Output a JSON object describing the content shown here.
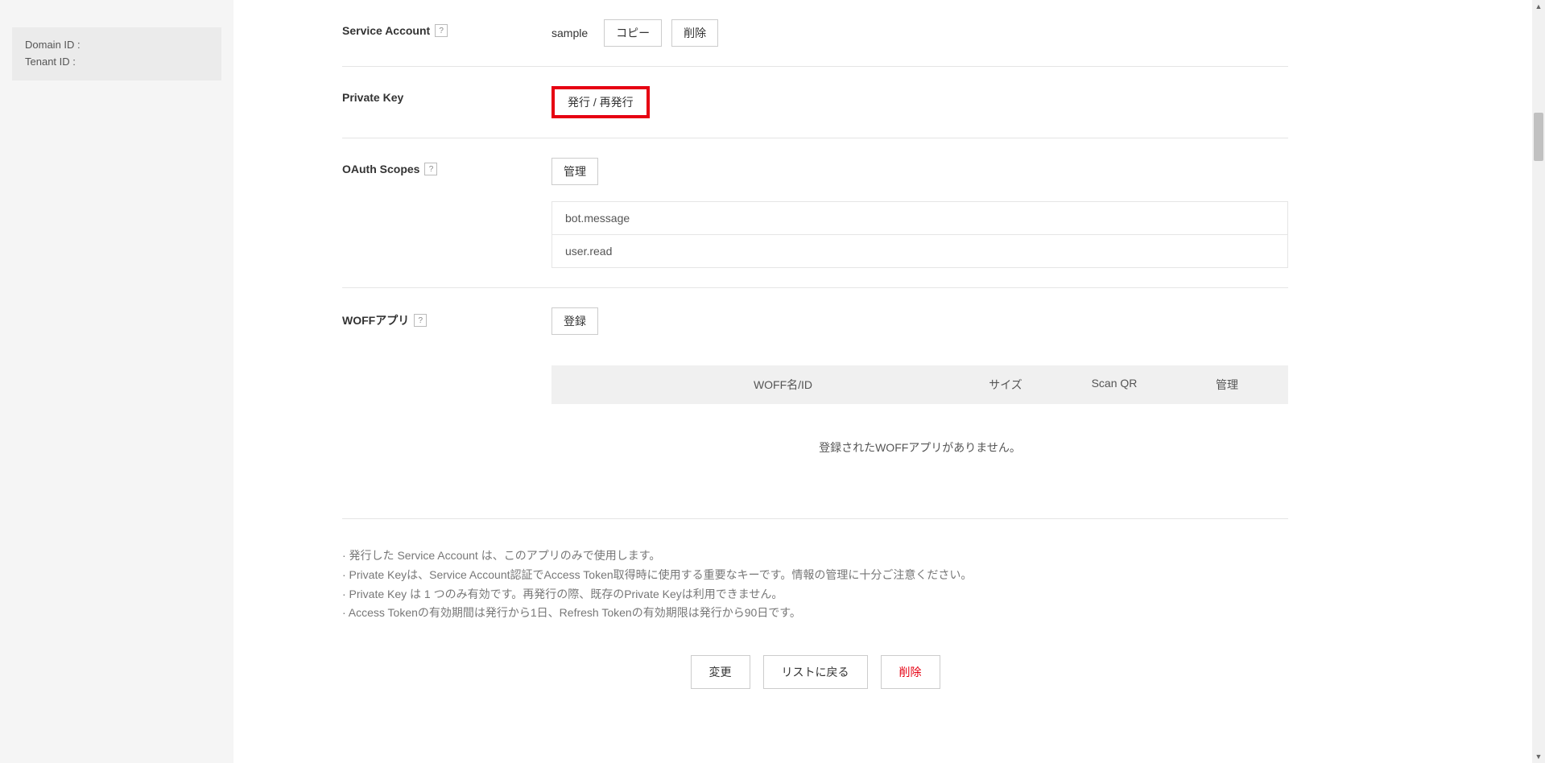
{
  "sidebar": {
    "domain_id_label": "Domain ID :",
    "tenant_id_label": "Tenant ID :"
  },
  "sections": {
    "service_account": {
      "label": "Service Account",
      "value": "sample",
      "copy_btn": "コピー",
      "delete_btn": "削除"
    },
    "private_key": {
      "label": "Private Key",
      "issue_btn": "発行 / 再発行"
    },
    "oauth_scopes": {
      "label": "OAuth Scopes",
      "manage_btn": "管理",
      "items": [
        "bot.message",
        "user.read"
      ]
    },
    "woff_app": {
      "label": "WOFFアプリ",
      "register_btn": "登録",
      "columns": {
        "name": "WOFF名/ID",
        "size": "サイズ",
        "qr": "Scan QR",
        "manage": "管理"
      },
      "empty_message": "登録されたWOFFアプリがありません。"
    }
  },
  "notes": [
    "· 発行した Service Account は、このアプリのみで使用します。",
    "· Private Keyは、Service Account認証でAccess Token取得時に使用する重要なキーです。情報の管理に十分ご注意ください。",
    "· Private Key は 1 つのみ有効です。再発行の際、既存のPrivate Keyは利用できません。",
    "· Access Tokenの有効期間は発行から1日、Refresh Tokenの有効期限は発行から90日です。"
  ],
  "footer": {
    "change_btn": "変更",
    "back_btn": "リストに戻る",
    "delete_btn": "削除"
  },
  "help_icon": "?"
}
